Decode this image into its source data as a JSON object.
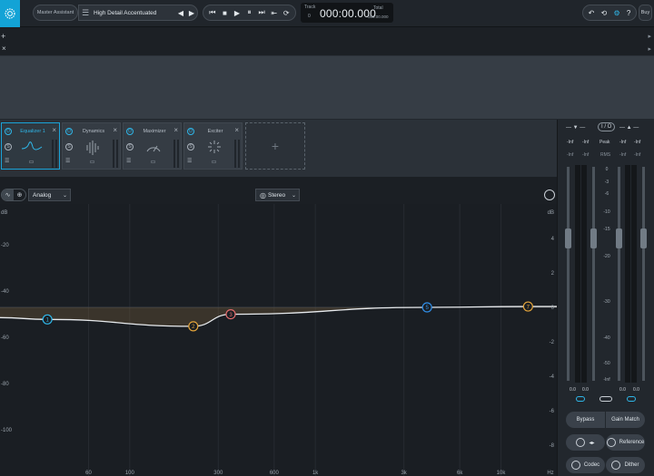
{
  "header": {
    "master_assistant": "Master Assistant",
    "preset_name": "High Detail Accentuated",
    "transport": [
      "⏮",
      "■",
      "▶",
      "⏸",
      "⏭",
      "⇤",
      "⟳"
    ],
    "track_label": "Track",
    "track_value": "0",
    "time": "000:00.000",
    "total_label": "Total",
    "total_value": "000:00.000",
    "right_icons": [
      "undo-icon",
      "history-icon",
      "settings-icon",
      "help-icon"
    ],
    "buy": "Buy"
  },
  "track_strip": {
    "add": "+",
    "remove": "×"
  },
  "modules": [
    {
      "name": "Equalizer 1",
      "active": true,
      "glyph": "eq-curve-icon"
    },
    {
      "name": "Dynamics",
      "active": false,
      "glyph": "dynamics-bars-icon"
    },
    {
      "name": "Maximizer",
      "active": false,
      "glyph": "gauge-icon"
    },
    {
      "name": "Exciter",
      "active": false,
      "glyph": "spark-icon"
    }
  ],
  "add_module": "+",
  "eq_toolbar": {
    "mode": "Analog",
    "channel": "Stereo"
  },
  "eq": {
    "left_unit": "dB",
    "left_ticks": [
      "-20",
      "-40",
      "-60",
      "-80",
      "-100"
    ],
    "right_unit": "dB",
    "right_ticks": [
      "4",
      "2",
      "0",
      "-2",
      "-4",
      "-6",
      "-8"
    ],
    "freq_ticks": [
      "60",
      "100",
      "300",
      "600",
      "1k",
      "3k",
      "6k",
      "10k",
      "Hz"
    ],
    "curve_color": "#e8ebee",
    "bands": [
      {
        "id": "1",
        "color": "#2fb6e8",
        "freq_hz": 36,
        "gain_db": -0.7
      },
      {
        "id": "2",
        "color": "#e2a33a",
        "freq_hz": 220,
        "gain_db": -1.1
      },
      {
        "id": "3",
        "color": "#e26b6b",
        "freq_hz": 350,
        "gain_db": -0.4
      },
      {
        "id": "5",
        "color": "#2f8ee8",
        "freq_hz": 4000,
        "gain_db": 0.0
      },
      {
        "id": "7",
        "color": "#e2a33a",
        "freq_hz": 14000,
        "gain_db": 0.05
      }
    ]
  },
  "meters": {
    "io_label": "I / O",
    "peak_label": "Peak",
    "rms_label": "RMS",
    "in_peak": [
      "-Inf",
      "-Inf"
    ],
    "in_rms": [
      "-Inf",
      "-Inf"
    ],
    "out_peak": [
      "-Inf",
      "-Inf"
    ],
    "out_rms": [
      "-Inf",
      "-Inf"
    ],
    "scale": [
      "0",
      "-3",
      "-6",
      "-10",
      "-15",
      "-20",
      "-30",
      "-40",
      "-50",
      "-Inf"
    ],
    "in_values": [
      "0.0",
      "0.0"
    ],
    "out_values": [
      "0.0",
      "0.0"
    ]
  },
  "bottom_buttons": {
    "bypass": "Bypass",
    "gain_match": "Gain Match",
    "reference": "Reference",
    "codec": "Codec",
    "dither": "Dither",
    "swap": "◂▸"
  }
}
